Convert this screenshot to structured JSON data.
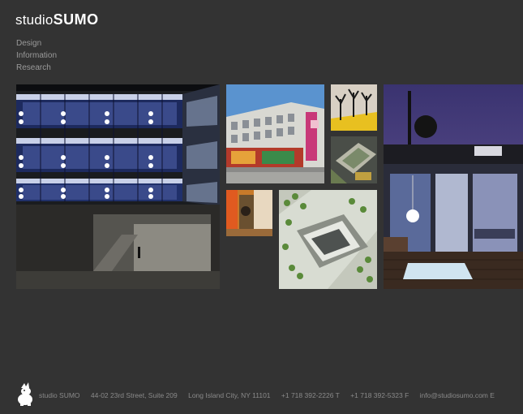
{
  "brand": {
    "logo_light": "studio",
    "logo_bold": "SUMO"
  },
  "nav": [
    {
      "label": "Design"
    },
    {
      "label": "Information"
    },
    {
      "label": "Research"
    }
  ],
  "footer": {
    "name": "studio SUMO",
    "address": "44-02 23rd Street, Suite 209",
    "city": "Long Island City, NY 11101",
    "phone": "+1 718 392-2226  T",
    "fax": "+1 718 392-5323  F",
    "email": "info@studiosumo.com  E"
  },
  "colors": {
    "background": "#333333",
    "text": "#9a9a9a",
    "logo": "#ffffff"
  }
}
